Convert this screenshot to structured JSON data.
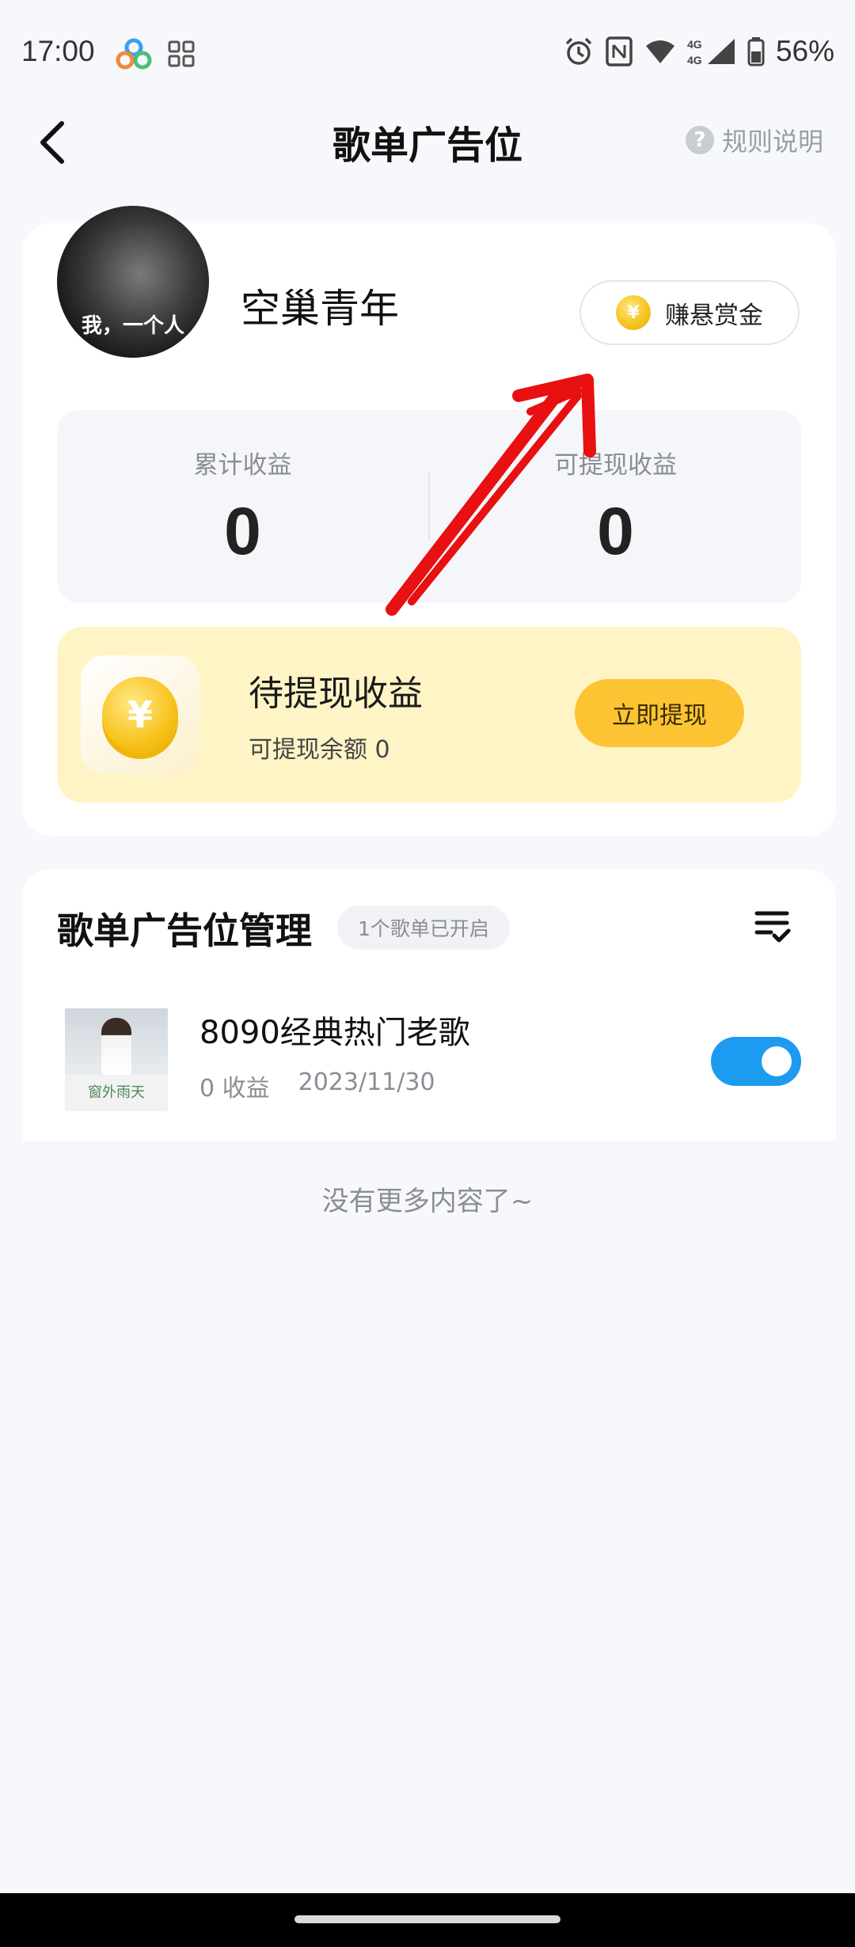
{
  "status_bar": {
    "time": "17:00",
    "battery": "56%",
    "network": "4G"
  },
  "header": {
    "title": "歌单广告位",
    "rules_label": "规则说明"
  },
  "profile": {
    "avatar_caption": "我，一个人",
    "name": "空巢青年",
    "bounty_label": "赚悬赏金",
    "coin_symbol": "¥"
  },
  "stats": [
    {
      "label": "累计收益",
      "value": "0"
    },
    {
      "label": "可提现收益",
      "value": "0"
    }
  ],
  "withdraw": {
    "title": "待提现收益",
    "subtitle": "可提现余额 0",
    "button_label": "立即提现",
    "coin_symbol": "¥"
  },
  "management": {
    "title": "歌单广告位管理",
    "badge": "1个歌单已开启",
    "playlists": [
      {
        "name": "8090经典热门老歌",
        "earnings": "0 收益",
        "date": "2023/11/30",
        "enabled": true,
        "cover_text": "窗外雨天"
      }
    ]
  },
  "footer": {
    "no_more": "没有更多内容了~"
  },
  "colors": {
    "accent_yellow": "#fcc433",
    "toggle_blue": "#1c9bf0",
    "annotation_red": "#e81010"
  }
}
